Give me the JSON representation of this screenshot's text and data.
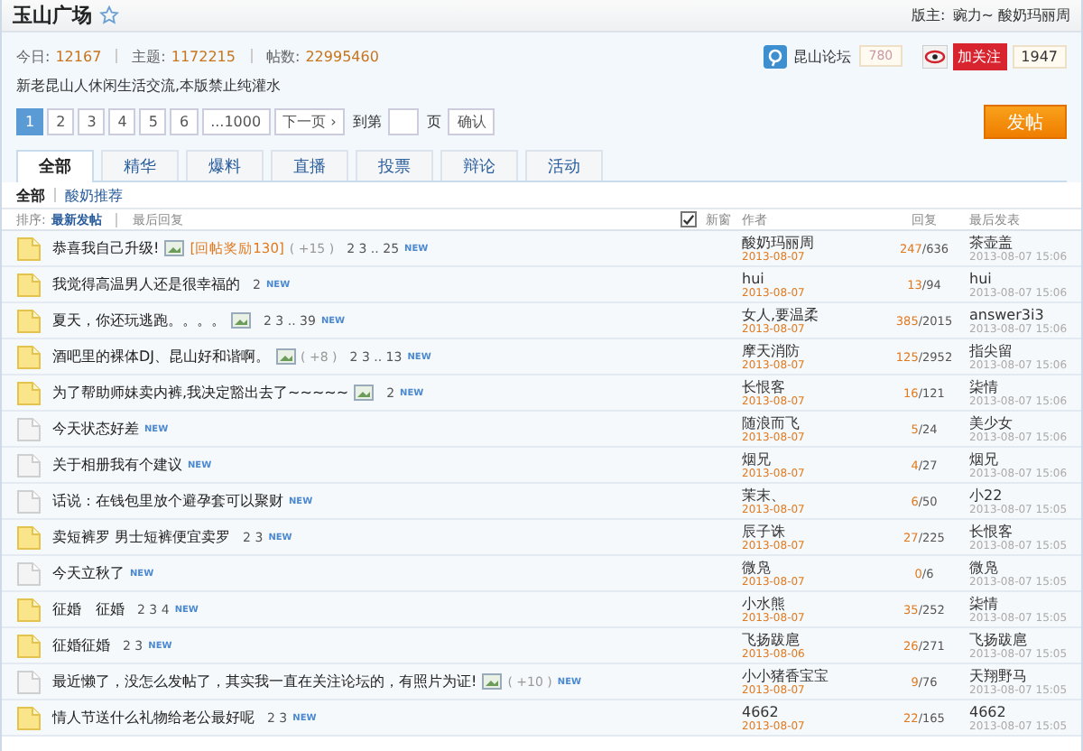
{
  "forum": {
    "title": "玉山广场",
    "moderator_label": "版主:",
    "moderators": "豌力~ 酸奶玛丽周"
  },
  "stats": [
    {
      "label": "今日:",
      "value": "12167"
    },
    {
      "label": "主题:",
      "value": "1172215"
    },
    {
      "label": "帖数:",
      "value": "22995460"
    }
  ],
  "description": "新老昆山人休闲生活交流,本版禁止纯灌水",
  "share": {
    "site": "昆山论坛",
    "site_count": "780",
    "follow": "加关注",
    "follow_count": "1947"
  },
  "pagination": {
    "pages": [
      {
        "label": "1",
        "selected": true
      },
      {
        "label": "2",
        "selected": false
      },
      {
        "label": "3",
        "selected": false
      },
      {
        "label": "4",
        "selected": false
      },
      {
        "label": "5",
        "selected": false
      },
      {
        "label": "6",
        "selected": false
      },
      {
        "label": "...1000",
        "selected": false
      }
    ],
    "next": "下一页 ›",
    "goto_prefix": "到第",
    "goto_suffix": "页",
    "confirm": "确认"
  },
  "post_button": "发帖",
  "tabs": [
    {
      "label": "全部",
      "selected": true
    },
    {
      "label": "精华",
      "selected": false
    },
    {
      "label": "爆料",
      "selected": false
    },
    {
      "label": "直播",
      "selected": false
    },
    {
      "label": "投票",
      "selected": false
    },
    {
      "label": "辩论",
      "selected": false
    },
    {
      "label": "活动",
      "selected": false
    }
  ],
  "subtabs": [
    {
      "label": "全部",
      "selected": true
    },
    {
      "label": "酸奶推荐",
      "selected": false
    }
  ],
  "sort": {
    "label": "排序:",
    "options": [
      {
        "label": "最新发帖",
        "selected": true
      },
      {
        "label": "最后回复",
        "selected": false
      }
    ],
    "new_window": {
      "label": "新窗",
      "checked": true
    }
  },
  "columns": {
    "author": "作者",
    "replies": "回复",
    "last": "最后发表"
  },
  "threads": [
    {
      "kind": "hot",
      "title": "恭喜我自己升级!",
      "image": true,
      "reward": "[回帖奖励130]",
      "plus": "( +15 )",
      "pages": "2 3 .. 25",
      "badge": "NEW",
      "author": "酸奶玛丽周",
      "date": "2013-08-07",
      "replies": "247",
      "views": "/636",
      "last_user": "茶壶盖",
      "last_time": "2013-08-07 15:06"
    },
    {
      "kind": "hot",
      "title": "我觉得高温男人还是很幸福的",
      "image": false,
      "pages": "2",
      "badge": "NEW",
      "author": "hui",
      "date": "2013-08-07",
      "replies": "13",
      "views": "/94",
      "last_user": "hui",
      "last_time": "2013-08-07 15:06"
    },
    {
      "kind": "hot",
      "title": "夏天，你还玩逃跑。。。。",
      "image": true,
      "pages": "2 3 .. 39",
      "badge": "NEW",
      "author": "女人,要温柔",
      "date": "2013-08-07",
      "replies": "385",
      "views": "/2015",
      "last_user": "answer3i3",
      "last_time": "2013-08-07 15:06"
    },
    {
      "kind": "hot",
      "title": "酒吧里的裸体DJ、昆山好和谐啊。",
      "image": true,
      "plus": "( +8 )",
      "pages": "2 3 .. 13",
      "badge": "NEW",
      "author": "摩天消防",
      "date": "2013-08-07",
      "replies": "125",
      "views": "/2952",
      "last_user": "指尖留",
      "last_time": "2013-08-07 15:06"
    },
    {
      "kind": "hot",
      "title": "为了帮助师妹卖内裤,我决定豁出去了~~~~~",
      "image": true,
      "pages": "2",
      "badge": "NEW",
      "author": "长恨客",
      "date": "2013-08-07",
      "replies": "16",
      "views": "/121",
      "last_user": "柒情",
      "last_time": "2013-08-07 15:06"
    },
    {
      "kind": "normal",
      "title": "今天状态好差",
      "image": false,
      "badge": "NEW",
      "author": "随浪而飞",
      "date": "2013-08-07",
      "replies": "5",
      "views": "/24",
      "last_user": "美少女",
      "last_time": "2013-08-07 15:06"
    },
    {
      "kind": "normal",
      "title": "关于相册我有个建议",
      "image": false,
      "badge": "NEW",
      "author": "烟兄",
      "date": "2013-08-07",
      "replies": "4",
      "views": "/27",
      "last_user": "烟兄",
      "last_time": "2013-08-07 15:06"
    },
    {
      "kind": "normal",
      "title": "话说：在钱包里放个避孕套可以聚财",
      "image": false,
      "badge": "NEW",
      "author": "茉末、",
      "date": "2013-08-07",
      "replies": "6",
      "views": "/50",
      "last_user": "小22",
      "last_time": "2013-08-07 15:05"
    },
    {
      "kind": "hot",
      "title": "卖短裤罗 男士短裤便宜卖罗",
      "image": false,
      "pages": "2 3",
      "badge": "NEW",
      "author": "辰子诛",
      "date": "2013-08-07",
      "replies": "27",
      "views": "/225",
      "last_user": "长恨客",
      "last_time": "2013-08-07 15:05"
    },
    {
      "kind": "normal",
      "title": "今天立秋了",
      "image": false,
      "badge": "NEW",
      "author": "微凫",
      "date": "2013-08-07",
      "replies": "0",
      "views": "/6",
      "last_user": "微凫",
      "last_time": "2013-08-07 15:05"
    },
    {
      "kind": "hot",
      "title": "征婚　征婚",
      "image": false,
      "pages": "2 3 4",
      "badge": "NEW",
      "author": "小水熊",
      "date": "2013-08-07",
      "replies": "35",
      "views": "/252",
      "last_user": "柒情",
      "last_time": "2013-08-07 15:05"
    },
    {
      "kind": "hot",
      "title": "征婚征婚",
      "image": false,
      "pages": "2 3",
      "badge": "NEW",
      "author": "飞扬跋扈",
      "date": "2013-08-06",
      "replies": "26",
      "views": "/271",
      "last_user": "飞扬跋扈",
      "last_time": "2013-08-07 15:05"
    },
    {
      "kind": "normal",
      "title": "最近懒了，没怎么发帖了，其实我一直在关注论坛的，有照片为证!",
      "image": true,
      "plus": "( +10 )",
      "badge": "NEW",
      "author": "小小猪香宝宝",
      "date": "2013-08-07",
      "replies": "9",
      "views": "/76",
      "last_user": "天翔野马",
      "last_time": "2013-08-07 15:05"
    },
    {
      "kind": "hot",
      "title": "情人节送什么礼物给老公最好呢",
      "image": false,
      "pages": "2 3",
      "badge": "NEW",
      "author": "4662",
      "date": "2013-08-07",
      "replies": "22",
      "views": "/165",
      "last_user": "4662",
      "last_time": "2013-08-07 15:05"
    }
  ]
}
